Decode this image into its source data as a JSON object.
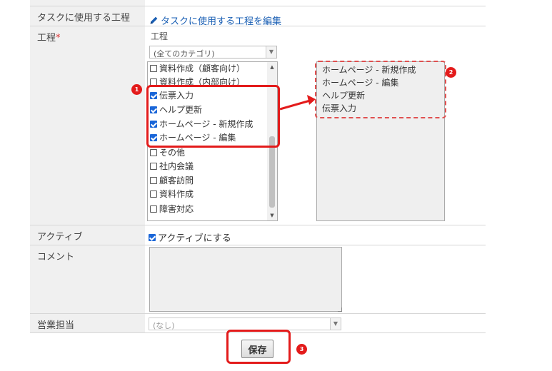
{
  "form": {
    "task_process_row": {
      "label": "タスクに使用する工程",
      "edit_link": "タスクに使用する工程を編集"
    },
    "process_row": {
      "label": "工程",
      "required_mark": "*",
      "sub_label": "工程",
      "category_select": "(全てのカテゴリ)",
      "process_items": [
        {
          "label": "資料作成（顧客向け）",
          "checked": false
        },
        {
          "label": "資料作成（内部向け）",
          "checked": false
        },
        {
          "label": "伝票入力",
          "checked": true
        },
        {
          "label": "ヘルプ更新",
          "checked": true
        },
        {
          "label": "ホームページ - 新規作成",
          "checked": true
        },
        {
          "label": "ホームページ - 編集",
          "checked": true
        },
        {
          "label": "その他",
          "checked": false
        },
        {
          "label": "社内会議",
          "checked": false
        },
        {
          "label": "顧客訪問",
          "checked": false
        },
        {
          "label": "資料作成",
          "checked": false
        },
        {
          "label": "障害対応",
          "checked": false
        }
      ],
      "selected_items": [
        "ホームページ - 新規作成",
        "ホームページ - 編集",
        "ヘルプ更新",
        "伝票入力"
      ]
    },
    "active_row": {
      "label": "アクティブ",
      "checkbox_label": "アクティブにする",
      "checked": true
    },
    "comment_row": {
      "label": "コメント",
      "value": ""
    },
    "sales_row": {
      "label": "営業担当",
      "select_value": "(なし)"
    },
    "save_label": "保存"
  },
  "annotations": {
    "badge1": "1",
    "badge2": "2",
    "badge3": "3"
  },
  "colors": {
    "highlight": "#e31b1b",
    "label_bg": "#f0f0f0",
    "link": "#1a5fb4"
  }
}
